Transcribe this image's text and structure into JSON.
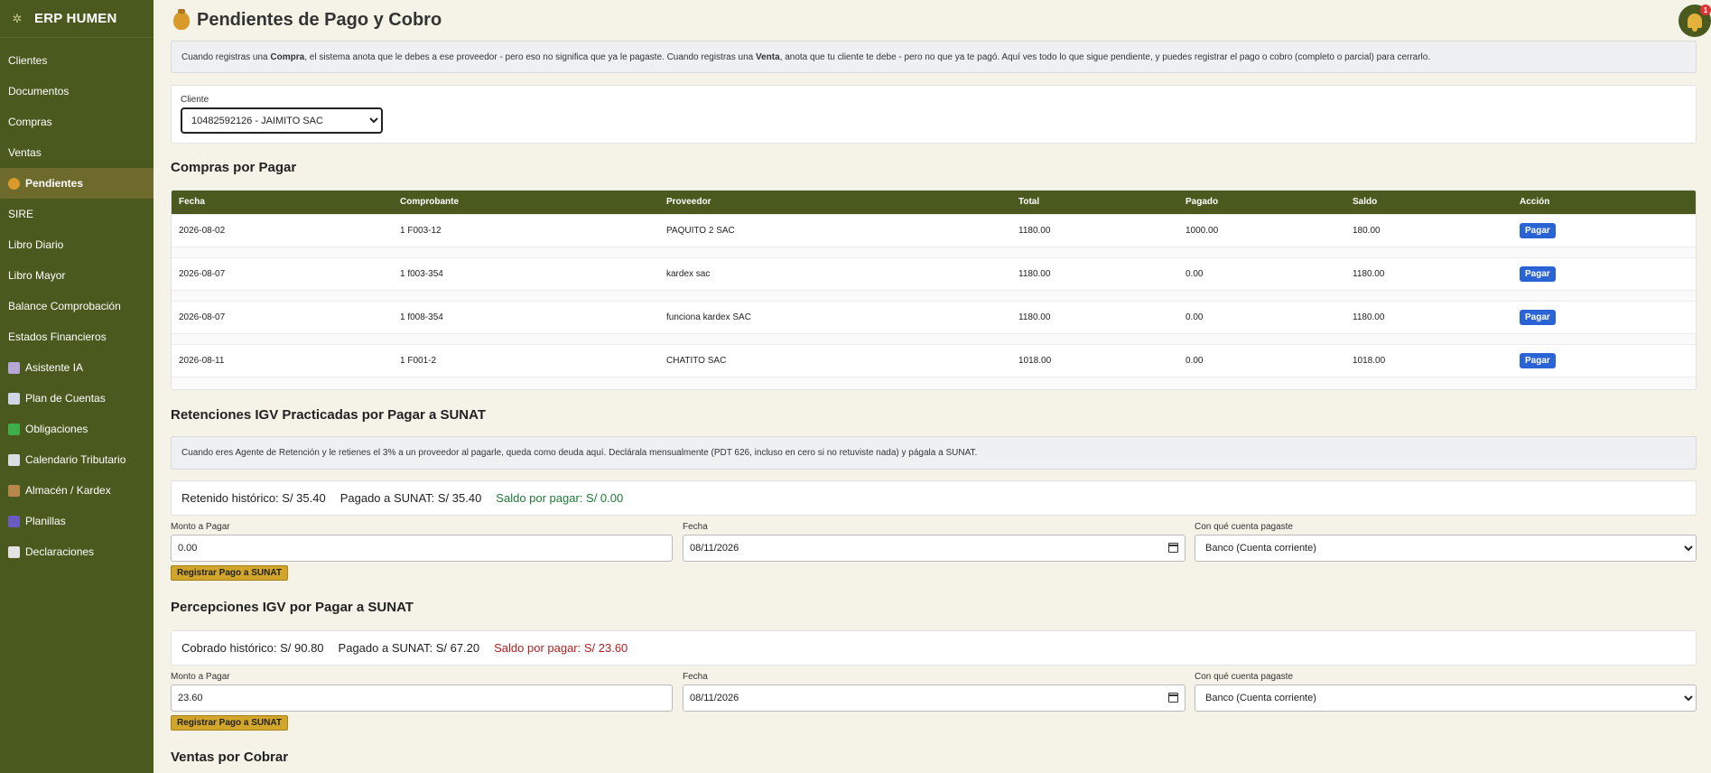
{
  "app": {
    "brand": "ERP HUMEN"
  },
  "sidebar": {
    "items": [
      {
        "label": "Clientes",
        "icon": ""
      },
      {
        "label": "Documentos",
        "icon": ""
      },
      {
        "label": "Compras",
        "icon": ""
      },
      {
        "label": "Ventas",
        "icon": ""
      },
      {
        "label": "Pendientes",
        "icon": "money-bag-icon",
        "active": true
      },
      {
        "label": "SIRE",
        "icon": ""
      },
      {
        "label": "Libro Diario",
        "icon": ""
      },
      {
        "label": "Libro Mayor",
        "icon": ""
      },
      {
        "label": "Balance Comprobación",
        "icon": ""
      },
      {
        "label": "Estados Financieros",
        "icon": ""
      },
      {
        "label": "Asistente IA",
        "icon": "robot-icon"
      },
      {
        "label": "Plan de Cuentas",
        "icon": "book-icon"
      },
      {
        "label": "Obligaciones",
        "icon": "checkbox-icon"
      },
      {
        "label": "Calendario Tributario",
        "icon": "calendar-icon"
      },
      {
        "label": "Almacén / Kardex",
        "icon": "box-icon"
      },
      {
        "label": "Planillas",
        "icon": "people-icon"
      },
      {
        "label": "Declaraciones",
        "icon": "document-icon"
      }
    ]
  },
  "page": {
    "title": "Pendientes de Pago y Cobro"
  },
  "notifications": {
    "count": "1"
  },
  "intro": {
    "p1": "Cuando registras una ",
    "compra": "Compra",
    "p2": ", el sistema anota que le debes a ese proveedor - pero eso no significa que ya le pagaste. Cuando registras una ",
    "venta": "Venta",
    "p3": ", anota que tu cliente te debe - pero no que ya te pagó. Aquí ves todo lo que sigue pendiente, y puedes registrar el pago o cobro (completo o parcial) para cerrarlo."
  },
  "client_filter": {
    "label": "Cliente",
    "selected": "10482592126 - JAIMITO SAC"
  },
  "purchases": {
    "title": "Compras por Pagar",
    "columns": [
      "Fecha",
      "Comprobante",
      "Proveedor",
      "Total",
      "Pagado",
      "Saldo",
      "Acción"
    ],
    "rows": [
      {
        "fecha": "2026-08-02",
        "comprobante": "1 F003-12",
        "proveedor": "PAQUITO 2 SAC",
        "total": "1180.00",
        "pagado": "1000.00",
        "saldo": "180.00",
        "accion": "Pagar"
      },
      {
        "fecha": "2026-08-07",
        "comprobante": "1 f003-354",
        "proveedor": "kardex sac",
        "total": "1180.00",
        "pagado": "0.00",
        "saldo": "1180.00",
        "accion": "Pagar"
      },
      {
        "fecha": "2026-08-07",
        "comprobante": "1 f008-354",
        "proveedor": "funciona kardex SAC",
        "total": "1180.00",
        "pagado": "0.00",
        "saldo": "1180.00",
        "accion": "Pagar"
      },
      {
        "fecha": "2026-08-11",
        "comprobante": "1 F001-2",
        "proveedor": "CHATITO SAC",
        "total": "1018.00",
        "pagado": "0.00",
        "saldo": "1018.00",
        "accion": "Pagar"
      }
    ]
  },
  "retenciones": {
    "title": "Retenciones IGV Practicadas por Pagar a SUNAT",
    "info": "Cuando eres Agente de Retención y le retienes el 3% a un proveedor al pagarle, queda como deuda aquí. Declárala mensualmente (PDT 626, incluso en cero si no retuviste nada) y págala a SUNAT.",
    "historico": "Retenido histórico: S/ 35.40",
    "pagado": "Pagado a SUNAT: S/ 35.40",
    "saldo": "Saldo por pagar: S/ 0.00",
    "form": {
      "amount_label": "Monto a Pagar",
      "amount_value": "0.00",
      "date_label": "Fecha",
      "date_value": "08/11/2026",
      "account_label": "Con qué cuenta pagaste",
      "account_value": "Banco (Cuenta corriente)",
      "submit": "Registrar Pago a SUNAT"
    }
  },
  "percepciones": {
    "title": "Percepciones IGV por Pagar a SUNAT",
    "historico": "Cobrado histórico: S/ 90.80",
    "pagado": "Pagado a SUNAT: S/ 67.20",
    "saldo": "Saldo por pagar: S/ 23.60",
    "form": {
      "amount_label": "Monto a Pagar",
      "amount_value": "23.60",
      "date_label": "Fecha",
      "date_value": "08/11/2026",
      "account_label": "Con qué cuenta pagaste",
      "account_value": "Banco (Cuenta corriente)",
      "submit": "Registrar Pago a SUNAT"
    }
  },
  "sales": {
    "title": "Ventas por Cobrar"
  },
  "colors": {
    "sidebar": "#4a5a1e",
    "active": "#6e6a2c",
    "accent_button": "#2a63d6",
    "register_button": "#d2a52b",
    "green": "#1e7a35",
    "red": "#b21f1f"
  }
}
